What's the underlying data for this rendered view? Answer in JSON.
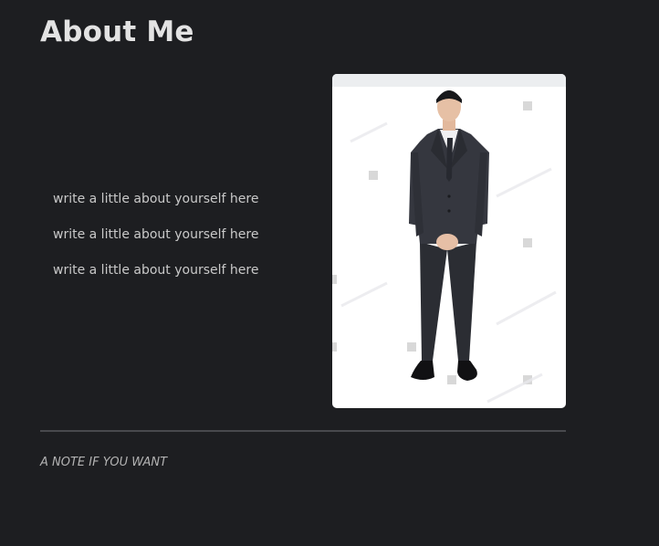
{
  "page": {
    "title": "About Me"
  },
  "about": {
    "lines": [
      "write a little about yourself here",
      "write a little about yourself here",
      "write a little about yourself here"
    ]
  },
  "photo": {
    "subject": "man-in-dark-suit-standing"
  },
  "footer": {
    "note": "A NOTE IF YOU WANT"
  },
  "colors": {
    "background": "#1d1e21",
    "title": "#e3e3e3",
    "body_text": "#c9c9c9",
    "divider": "#48494d"
  }
}
